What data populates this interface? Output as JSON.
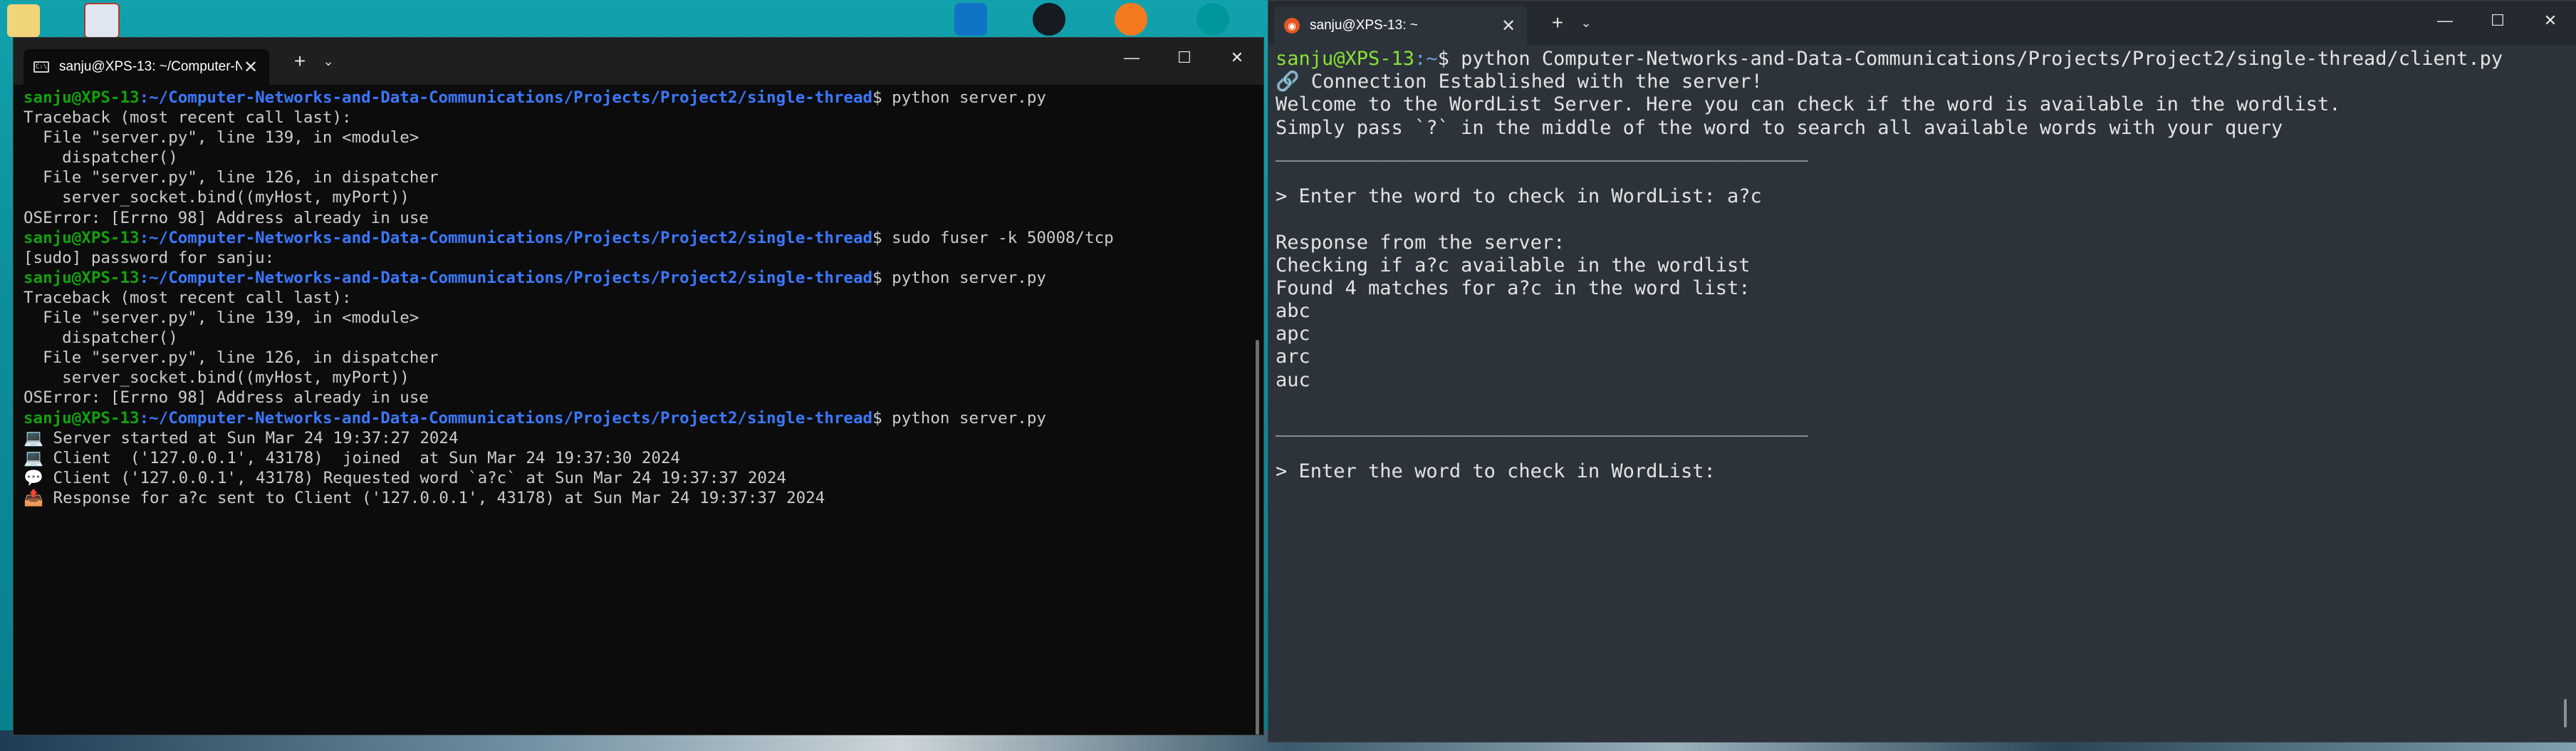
{
  "desktop": {
    "icons": [
      "folder-icon",
      "monitor-app-icon",
      "vscode-icon",
      "github-icon",
      "git-app-icon",
      "arduino-icon"
    ]
  },
  "left_window": {
    "tab_title": "sanju@XPS-13: ~/Computer-N",
    "tab_close": "✕",
    "new_tab": "+",
    "dropdown": "⌄",
    "controls": {
      "minimize": "—",
      "maximize": "☐",
      "close": "✕"
    },
    "lines": [
      {
        "user": "sanju@XPS-13",
        "path": ":~/Computer-Networks-and-Data-Communications/Projects/Project2/single-thread",
        "text": "$ python server.py"
      },
      {
        "text": "Traceback (most recent call last):"
      },
      {
        "text": "  File \"server.py\", line 139, in <module>"
      },
      {
        "text": "    dispatcher()"
      },
      {
        "text": "  File \"server.py\", line 126, in dispatcher"
      },
      {
        "text": "    server_socket.bind((myHost, myPort))"
      },
      {
        "text": "OSError: [Errno 98] Address already in use"
      },
      {
        "user": "sanju@XPS-13",
        "path": ":~/Computer-Networks-and-Data-Communications/Projects/Project2/single-thread",
        "text": "$ sudo fuser -k 50008/tcp"
      },
      {
        "text": "[sudo] password for sanju:"
      },
      {
        "user": "sanju@XPS-13",
        "path": ":~/Computer-Networks-and-Data-Communications/Projects/Project2/single-thread",
        "text": "$ python server.py"
      },
      {
        "text": "Traceback (most recent call last):"
      },
      {
        "text": "  File \"server.py\", line 139, in <module>"
      },
      {
        "text": "    dispatcher()"
      },
      {
        "text": "  File \"server.py\", line 126, in dispatcher"
      },
      {
        "text": "    server_socket.bind((myHost, myPort))"
      },
      {
        "text": "OSError: [Errno 98] Address already in use"
      },
      {
        "user": "sanju@XPS-13",
        "path": ":~/Computer-Networks-and-Data-Communications/Projects/Project2/single-thread",
        "text": "$ python server.py"
      },
      {
        "text": "💻 Server started at Sun Mar 24 19:37:27 2024"
      },
      {
        "text": "💻 Client  ('127.0.0.1', 43178)  joined  at Sun Mar 24 19:37:30 2024"
      },
      {
        "text": "💬 Client ('127.0.0.1', 43178) Requested word `a?c` at Sun Mar 24 19:37:37 2024"
      },
      {
        "text": "📤 Response for a?c sent to Client ('127.0.0.1', 43178) at Sun Mar 24 19:37:37 2024"
      }
    ]
  },
  "right_window": {
    "tab_title": "sanju@XPS-13: ~",
    "tab_close": "✕",
    "new_tab": "+",
    "dropdown": "⌄",
    "controls": {
      "minimize": "—",
      "maximize": "☐",
      "close": "✕"
    },
    "lines": [
      {
        "user": "sanju@XPS-13",
        "path": ":~",
        "text": "$ python Computer-Networks-and-Data-Communications/Projects/Project2/single-thread/client.py"
      },
      {
        "text": "🔗 Connection Established with the server!"
      },
      {
        "text": "Welcome to the WordList Server. Here you can check if the word is available in the wordlist."
      },
      {
        "text": "Simply pass `?` in the middle of the word to search all available words with your query"
      },
      {
        "text": "______________________________________________"
      },
      {
        "text": ""
      },
      {
        "text": "> Enter the word to check in WordList: a?c"
      },
      {
        "text": ""
      },
      {
        "text": "Response from the server:"
      },
      {
        "text": "Checking if a?c available in the wordlist"
      },
      {
        "text": "Found 4 matches for a?c in the word list:"
      },
      {
        "text": "abc"
      },
      {
        "text": "apc"
      },
      {
        "text": "arc"
      },
      {
        "text": "auc"
      },
      {
        "text": ""
      },
      {
        "text": "______________________________________________"
      },
      {
        "text": ""
      },
      {
        "text": "> Enter the word to check in WordList:"
      }
    ]
  }
}
